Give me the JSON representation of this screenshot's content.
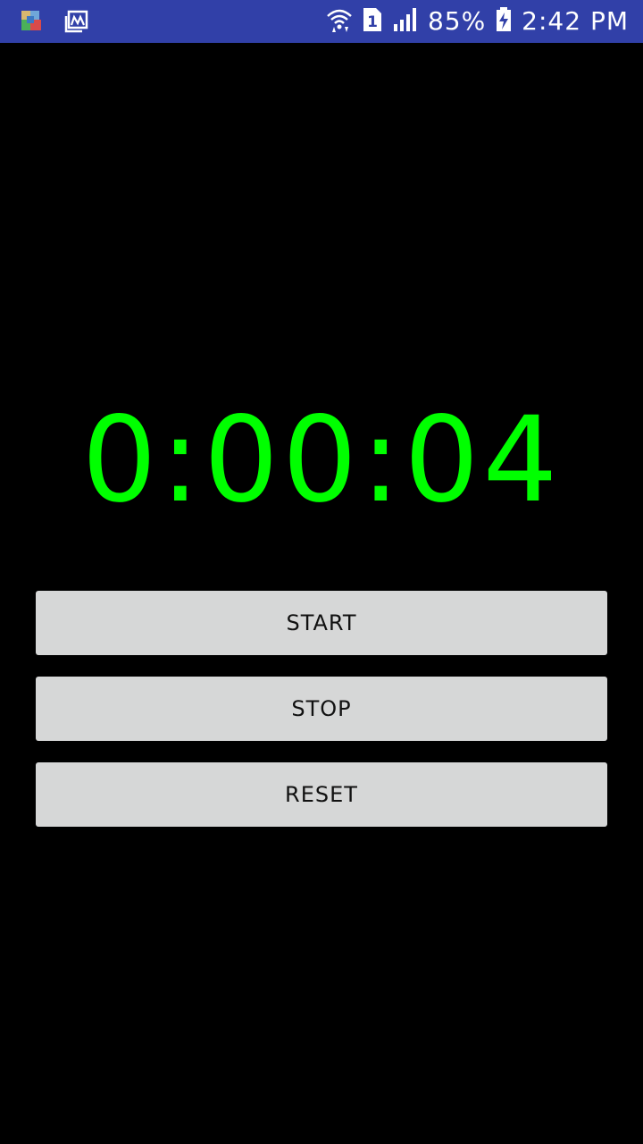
{
  "status_bar": {
    "left_icons": [
      "app-notification-icon",
      "gallery-notification-icon"
    ],
    "right_icons": [
      "wifi-icon",
      "sim-1-icon",
      "signal-icon",
      "battery-charging-icon"
    ],
    "sim_label": "1",
    "battery_percent": "85%",
    "time": "2:42 PM",
    "color": "#3140a8"
  },
  "stopwatch": {
    "time_display": "0:00:04",
    "color": "#00ff00"
  },
  "buttons": {
    "start": "START",
    "stop": "STOP",
    "reset": "RESET",
    "background": "#d6d7d7"
  },
  "background_color": "#000000"
}
